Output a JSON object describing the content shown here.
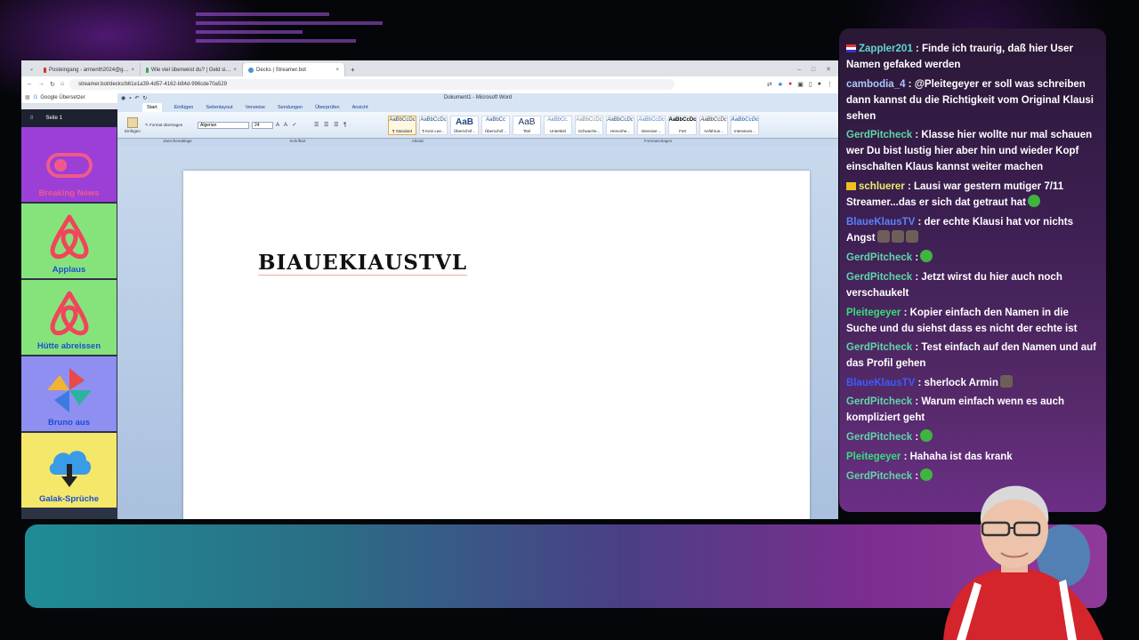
{
  "browser": {
    "tabs": [
      {
        "label": "Posteingang - armenth2024@g…",
        "active": false
      },
      {
        "label": "Wie viel überweist du? | Geld si…",
        "active": false
      },
      {
        "label": "Decks | Streamer.bot",
        "active": true
      }
    ],
    "new_tab": "+",
    "url": "streamer.bot/decks/b61e1a39-4d57-4162-b84d-996cde70a529",
    "bookmark": "Google Übersetzer"
  },
  "deck": {
    "page_label": "Seite 1",
    "buttons": [
      {
        "label": "Breaking News",
        "color": "#9b3fd6",
        "label_color": "#f05a8a",
        "icon": "toggle-icon"
      },
      {
        "label": "Applaus",
        "color": "#86e37c",
        "label_color": "#1a4fd6",
        "icon": "airbnb-icon"
      },
      {
        "label": "Hütte abreissen",
        "color": "#86e37c",
        "label_color": "#1a4fd6",
        "icon": "airbnb-icon"
      },
      {
        "label": "Bruno aus",
        "color": "#8e8ff0",
        "label_color": "#1a4fd6",
        "icon": "pinwheel-icon"
      },
      {
        "label": "Galak-Sprüche",
        "color": "#f5e76a",
        "label_color": "#1a4fd6",
        "icon": "cloud-download-icon"
      }
    ]
  },
  "word": {
    "title": "Dokument1 - Microsoft Word",
    "ribbon_tabs": [
      "Start",
      "Einfügen",
      "Seitenlayout",
      "Verweise",
      "Sendungen",
      "Überprüfen",
      "Ansicht"
    ],
    "font": "Algerian",
    "font_size": "24",
    "styles": [
      {
        "sample": "AaBbCcDc",
        "name": "¶ Standard"
      },
      {
        "sample": "AaBbCcDc",
        "name": "¶ Kein Lee..."
      },
      {
        "sample": "AaB",
        "name": "Überschrif..."
      },
      {
        "sample": "AaBbCc",
        "name": "Überschrif..."
      },
      {
        "sample": "AaB",
        "name": "Titel"
      },
      {
        "sample": "AaBbCc.",
        "name": "Untertitel"
      },
      {
        "sample": "AaBbCcDc",
        "name": "Schwache..."
      },
      {
        "sample": "AaBbCcDc",
        "name": "Hervorhe..."
      },
      {
        "sample": "AaBbCcDc",
        "name": "Intensive ..."
      },
      {
        "sample": "AaBbCcDc",
        "name": "Fett"
      },
      {
        "sample": "AaBbCcDc",
        "name": "Anführun..."
      },
      {
        "sample": "AaBbCcDc",
        "name": "Intensives..."
      }
    ],
    "groups": [
      "Zwischenablage",
      "Schriftart",
      "Absatz",
      "Formatvorlagen"
    ],
    "paste_label": "Einfügen",
    "format_label": "Format übertragen",
    "doc_text": "BIAUEKIAUSTVL"
  },
  "chat": [
    {
      "user": "Zappler201",
      "user_color": "#5fd7d0",
      "text": " : Finde ich traurig, daß hier User Namen gefaked werden",
      "badge": "flag"
    },
    {
      "user": "cambodia_4",
      "user_color": "#a8c8ff",
      "text": " : @Pleitegeyer er soll was schreiben dann kannst du die Richtigkeit vom Original Klausi sehen"
    },
    {
      "user": "GerdPitcheck",
      "user_color": "#5fd7a8",
      "text": " : Klasse hier wollte nur mal schauen wer Du bist lustig hier aber hin und wieder Kopf einschalten Klaus kannst weiter machen"
    },
    {
      "user": "schluerer",
      "user_color": "#e8f06a",
      "text": " : Lausi war gestern mutiger 7/11 Streamer...das er sich dat getraut hat",
      "badge": "crown",
      "emote": "green"
    },
    {
      "user": "BlaueKlausTV",
      "user_color": "#5a82ff",
      "text": " : der echte Klausi hat vor nichts Angst",
      "emote": "gray3"
    },
    {
      "user": "GerdPitcheck",
      "user_color": "#5fd7a8",
      "text": " :",
      "emote": "green"
    },
    {
      "user": "GerdPitcheck",
      "user_color": "#5fd7a8",
      "text": " : Jetzt wirst du hier auch noch verschaukelt"
    },
    {
      "user": "Pleitegeyer",
      "user_color": "#33e07a",
      "text": " : Kopier einfach den Namen in die Suche und du siehst dass es nicht der echte ist"
    },
    {
      "user": "GerdPitcheck",
      "user_color": "#5fd7a8",
      "text": " : Test einfach auf den Namen und auf das Profil gehen"
    },
    {
      "user": "BlaueKlausTV",
      "user_color": "#3a5cff",
      "text": " : sherlock Armin",
      "emote": "gray"
    },
    {
      "user": "GerdPitcheck",
      "user_color": "#5fd7a8",
      "text": " : Warum einfach wenn es auch kompliziert geht"
    },
    {
      "user": "GerdPitcheck",
      "user_color": "#5fd7a8",
      "text": " :",
      "emote": "green"
    },
    {
      "user": "Pleitegeyer",
      "user_color": "#33e07a",
      "text": " : Hahaha ist das krank"
    },
    {
      "user": "GerdPitcheck",
      "user_color": "#5fd7a8",
      "text": " :",
      "emote": "green"
    }
  ]
}
